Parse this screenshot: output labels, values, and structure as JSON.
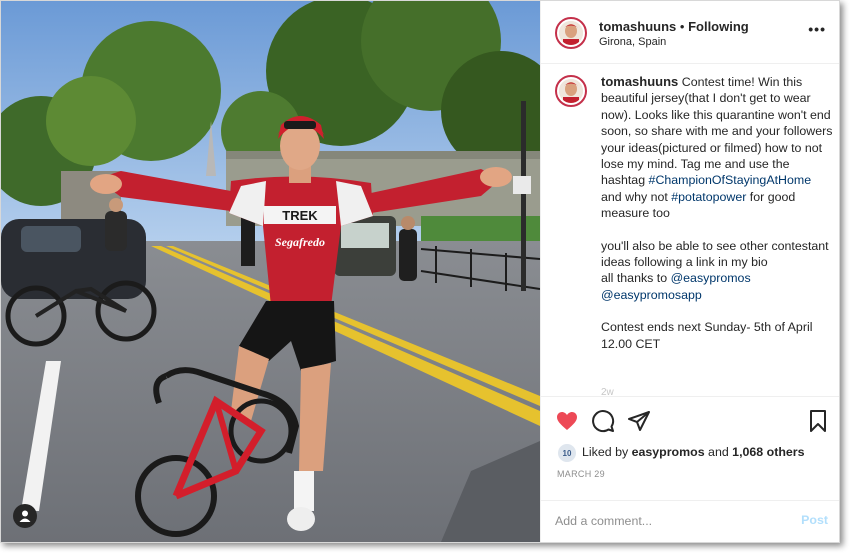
{
  "photo": {
    "jersey_brand": "TREK",
    "jersey_sponsor": "Segafredo",
    "user_tag_icon": "person-icon"
  },
  "header": {
    "username": "tomashuuns",
    "separator": " • ",
    "follow_status": "Following",
    "location": "Girona, Spain",
    "more_icon": "ellipsis-icon",
    "more_glyph": "•••"
  },
  "caption": {
    "username": "tomashuuns",
    "text_1": " Contest time! Win this beautiful jersey(that I don't get to wear now). Looks like this quarantine won't end soon, so share with me and your followers your ideas(pictured or filmed) how to not lose my mind. Tag me and use the hashtag ",
    "hashtag_1": "#ChampionOfStayingAtHome",
    "text_2": " and why not ",
    "hashtag_2": "#potatopower",
    "text_3": " for good measure too",
    "para_2": "you'll also be able to see other contestant ideas following a link in my bio",
    "thanks_prefix": "all thanks to ",
    "mention_1": "@easypromos",
    "mention_2": "@easypromosapp",
    "contest_end": "Contest ends next Sunday- 5th of April 12.00 CET",
    "cut_off": "2w"
  },
  "actions": {
    "like_icon": "heart-icon",
    "comment_icon": "comment-bubble-icon",
    "share_icon": "paper-plane-icon",
    "save_icon": "bookmark-icon",
    "accent_color": "#ed4956"
  },
  "likes": {
    "avatar_text": "10",
    "prefix": "Liked by ",
    "user": "easypromos",
    "middle": " and ",
    "others": "1,068 others"
  },
  "date": "MARCH 29",
  "comment": {
    "placeholder": "Add a comment...",
    "post_label": "Post"
  }
}
